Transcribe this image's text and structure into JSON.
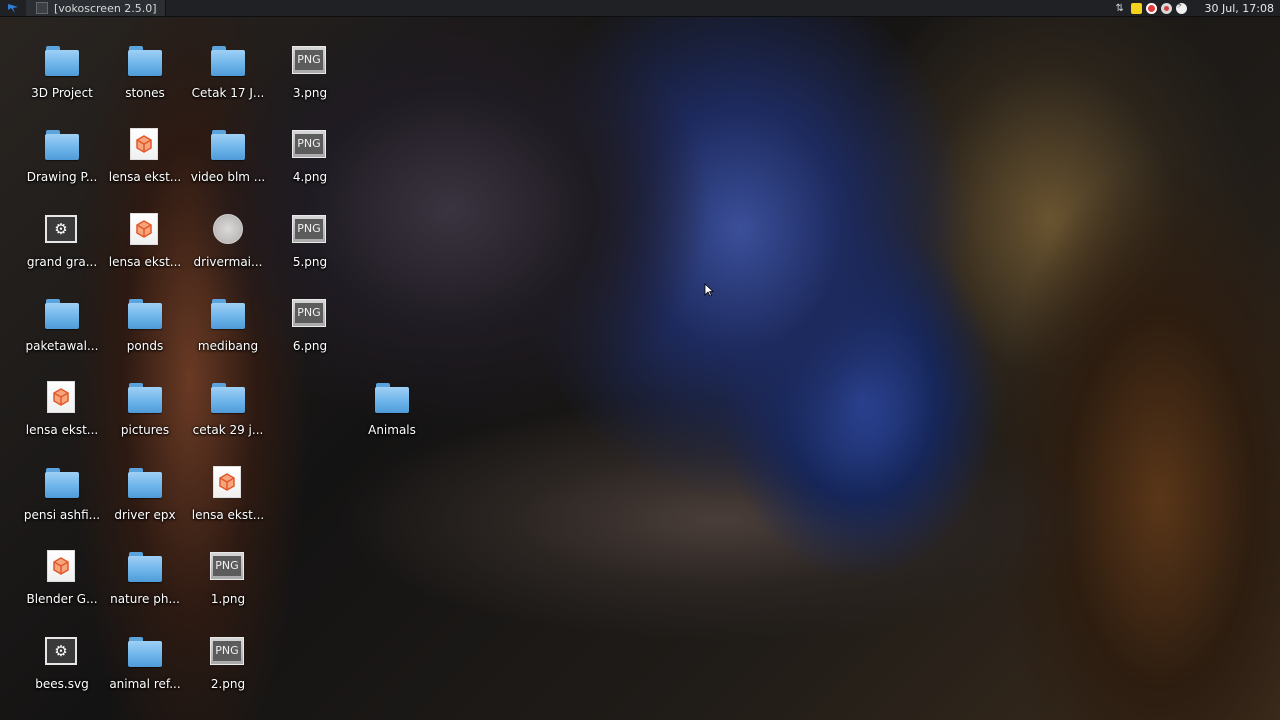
{
  "panel": {
    "window_title": "[vokoscreen 2.5.0]",
    "clock": "30 Jul, 17:08",
    "tray_icons": [
      "network-icon",
      "note-icon",
      "record-icon",
      "recorder-icon",
      "power-icon"
    ]
  },
  "desktop": {
    "icons": [
      {
        "label": "3D Project",
        "type": "folder"
      },
      {
        "label": "Drawing P...",
        "type": "folder"
      },
      {
        "label": "grand gra...",
        "type": "gear"
      },
      {
        "label": "paketawal...",
        "type": "folder"
      },
      {
        "label": "lensa ekst...",
        "type": "cube"
      },
      {
        "label": "pensi ashfi...",
        "type": "folder"
      },
      {
        "label": "Blender G...",
        "type": "cube"
      },
      {
        "label": "bees.svg",
        "type": "gear"
      },
      {
        "label": "stones",
        "type": "folder"
      },
      {
        "label": "lensa ekst...",
        "type": "cube"
      },
      {
        "label": "lensa ekst...",
        "type": "cube"
      },
      {
        "label": "ponds",
        "type": "folder"
      },
      {
        "label": "pictures",
        "type": "folder"
      },
      {
        "label": "driver epx",
        "type": "folder"
      },
      {
        "label": "nature ph...",
        "type": "folder"
      },
      {
        "label": "animal ref...",
        "type": "folder"
      },
      {
        "label": "Cetak 17 J...",
        "type": "folder"
      },
      {
        "label": "video blm ...",
        "type": "folder"
      },
      {
        "label": "drivermai...",
        "type": "disc"
      },
      {
        "label": "medibang",
        "type": "folder"
      },
      {
        "label": "cetak 29 j...",
        "type": "folder"
      },
      {
        "label": "lensa ekst...",
        "type": "cube"
      },
      {
        "label": "1.png",
        "type": "png"
      },
      {
        "label": "2.png",
        "type": "png"
      },
      {
        "label": "3.png",
        "type": "png"
      },
      {
        "label": "4.png",
        "type": "png"
      },
      {
        "label": "5.png",
        "type": "png"
      },
      {
        "label": "6.png",
        "type": "png"
      },
      {
        "label": "Animals",
        "type": "folder"
      }
    ],
    "png_badge": "PNG"
  }
}
